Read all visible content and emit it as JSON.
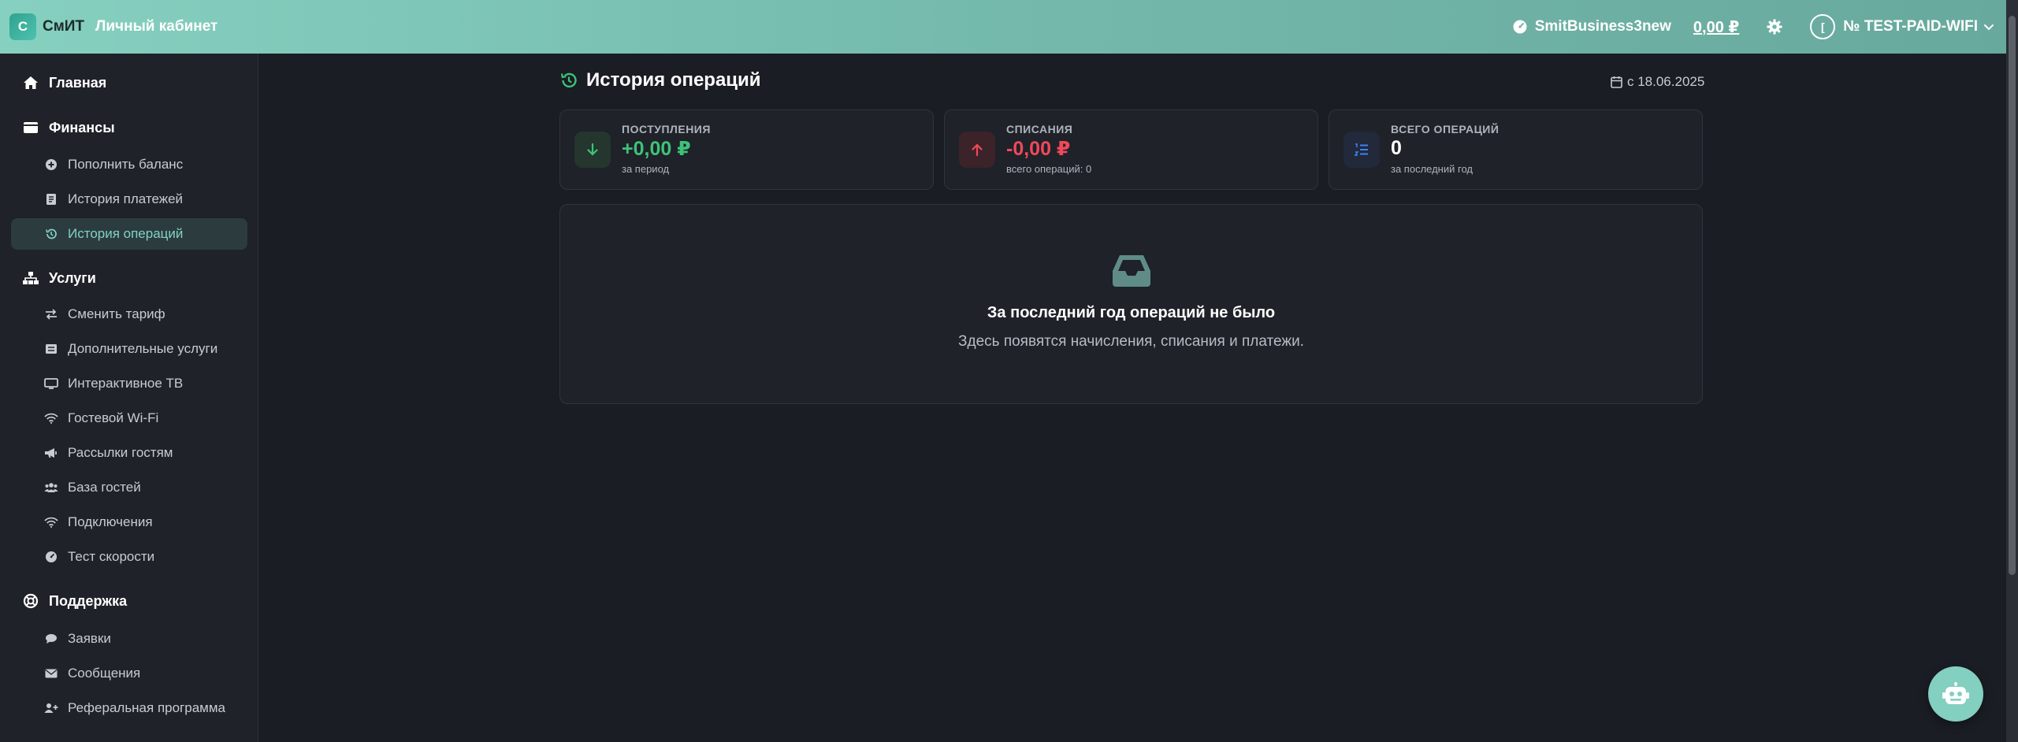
{
  "header": {
    "logo_letter": "С",
    "logo_text": "СмИТ",
    "cabinet_label": "Личный кабинет",
    "business_name": "SmitBusiness3new",
    "balance": "0,00 ₽",
    "account_initial": "[",
    "account_name": "№ TEST-PAID-WIFI"
  },
  "sidebar": {
    "home": "Главная",
    "finance": {
      "label": "Финансы",
      "items": [
        "Пополнить баланс",
        "История платежей",
        "История операций"
      ]
    },
    "services": {
      "label": "Услуги",
      "items": [
        "Сменить тариф",
        "Дополнительные услуги",
        "Интерактивное ТВ",
        "Гостевой Wi-Fi",
        "Рассылки гостям",
        "База гостей",
        "Подключения",
        "Тест скорости"
      ]
    },
    "support": {
      "label": "Поддержка",
      "items": [
        "Заявки",
        "Сообщения",
        "Реферальная программа"
      ]
    }
  },
  "main": {
    "title": "История операций",
    "date_label": "с 18.06.2025",
    "cards": [
      {
        "key": "ПОСТУПЛЕНИЯ",
        "value": "+0,00 ₽",
        "sub": "за период"
      },
      {
        "key": "СПИСАНИЯ",
        "value": "-0,00 ₽",
        "sub": "всего операций: 0"
      },
      {
        "key": "ВСЕГО ОПЕРАЦИЙ",
        "value": "0",
        "sub": "за последний год"
      }
    ],
    "empty_title": "За последний год операций не было",
    "empty_text": "Здесь появятся начисления, списания и платежи."
  },
  "colors": {
    "accent": "#7fd3c1",
    "positive": "#3ec27a",
    "negative": "#f0485a",
    "info": "#3b82f6",
    "background": "#1a1d23"
  }
}
